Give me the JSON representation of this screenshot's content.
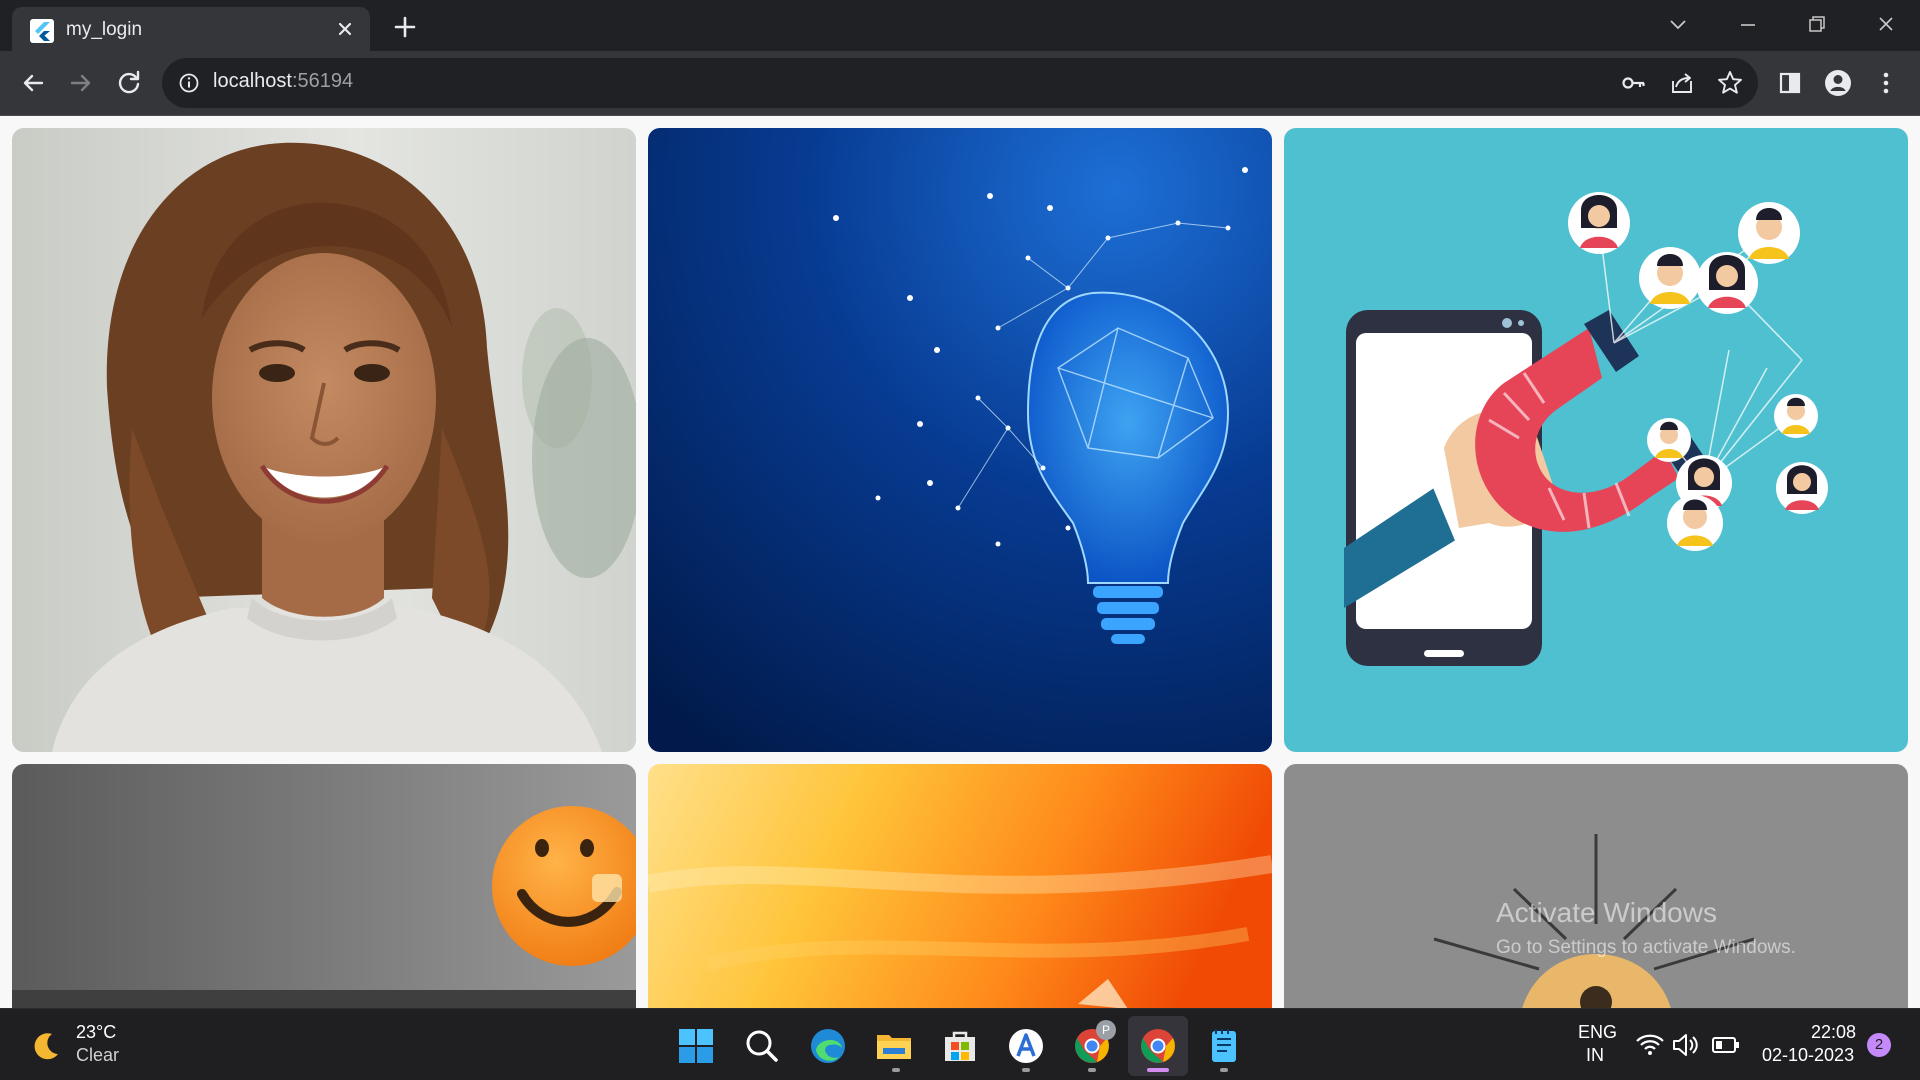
{
  "browser": {
    "tab": {
      "title": "my_login"
    },
    "address": {
      "host": "localhost",
      "port": ":56194"
    }
  },
  "watermark": {
    "title": "Activate Windows",
    "subtitle": "Go to Settings to activate Windows."
  },
  "taskbar": {
    "weather": {
      "temp": "23°C",
      "condition": "Clear"
    },
    "language": {
      "line1": "ENG",
      "line2": "IN"
    },
    "clock": {
      "time": "22:08",
      "date": "02-10-2023"
    },
    "notification_count": "2",
    "chrome_profile_badge": "P"
  },
  "colors": {
    "tab_strip": "#202124",
    "toolbar": "#35363a",
    "taskbar": "#1f1f22",
    "tile_cyan": "#4fc0d0",
    "notification_badge": "#c58af9"
  }
}
